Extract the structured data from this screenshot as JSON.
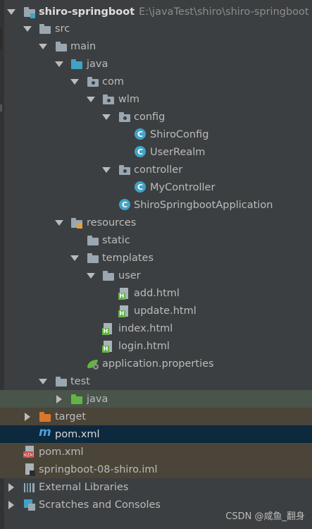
{
  "project": {
    "name": "shiro-springboot",
    "path": "E:\\javaTest\\shiro\\shiro-springboot"
  },
  "tree": {
    "src": "src",
    "main": "main",
    "java": "java",
    "com": "com",
    "wlm": "wlm",
    "config": "config",
    "shiro_config": "ShiroConfig",
    "user_realm": "UserRealm",
    "controller": "controller",
    "my_controller": "MyController",
    "application_class": "ShiroSpringbootApplication",
    "resources": "resources",
    "static": "static",
    "templates": "templates",
    "user": "user",
    "add_html": "add.html",
    "update_html": "update.html",
    "index_html": "index.html",
    "login_html": "login.html",
    "application_properties": "application.properties",
    "test": "test",
    "test_java": "java",
    "target": "target",
    "pom_selected": "pom.xml",
    "pom_root": "pom.xml",
    "iml": "springboot-08-shiro.iml",
    "external_libraries": "External Libraries",
    "scratches": "Scratches and Consoles"
  },
  "class_icon_letter": "C",
  "html_icon_letter": "H",
  "maven_icon_letter": "m",
  "watermark": "CSDN @咸鱼_翻身",
  "colors": {
    "background": "#3c3f41",
    "selected_row": "#0d293e",
    "test_row": "#49544a",
    "excluded_row": "#4a4538"
  }
}
